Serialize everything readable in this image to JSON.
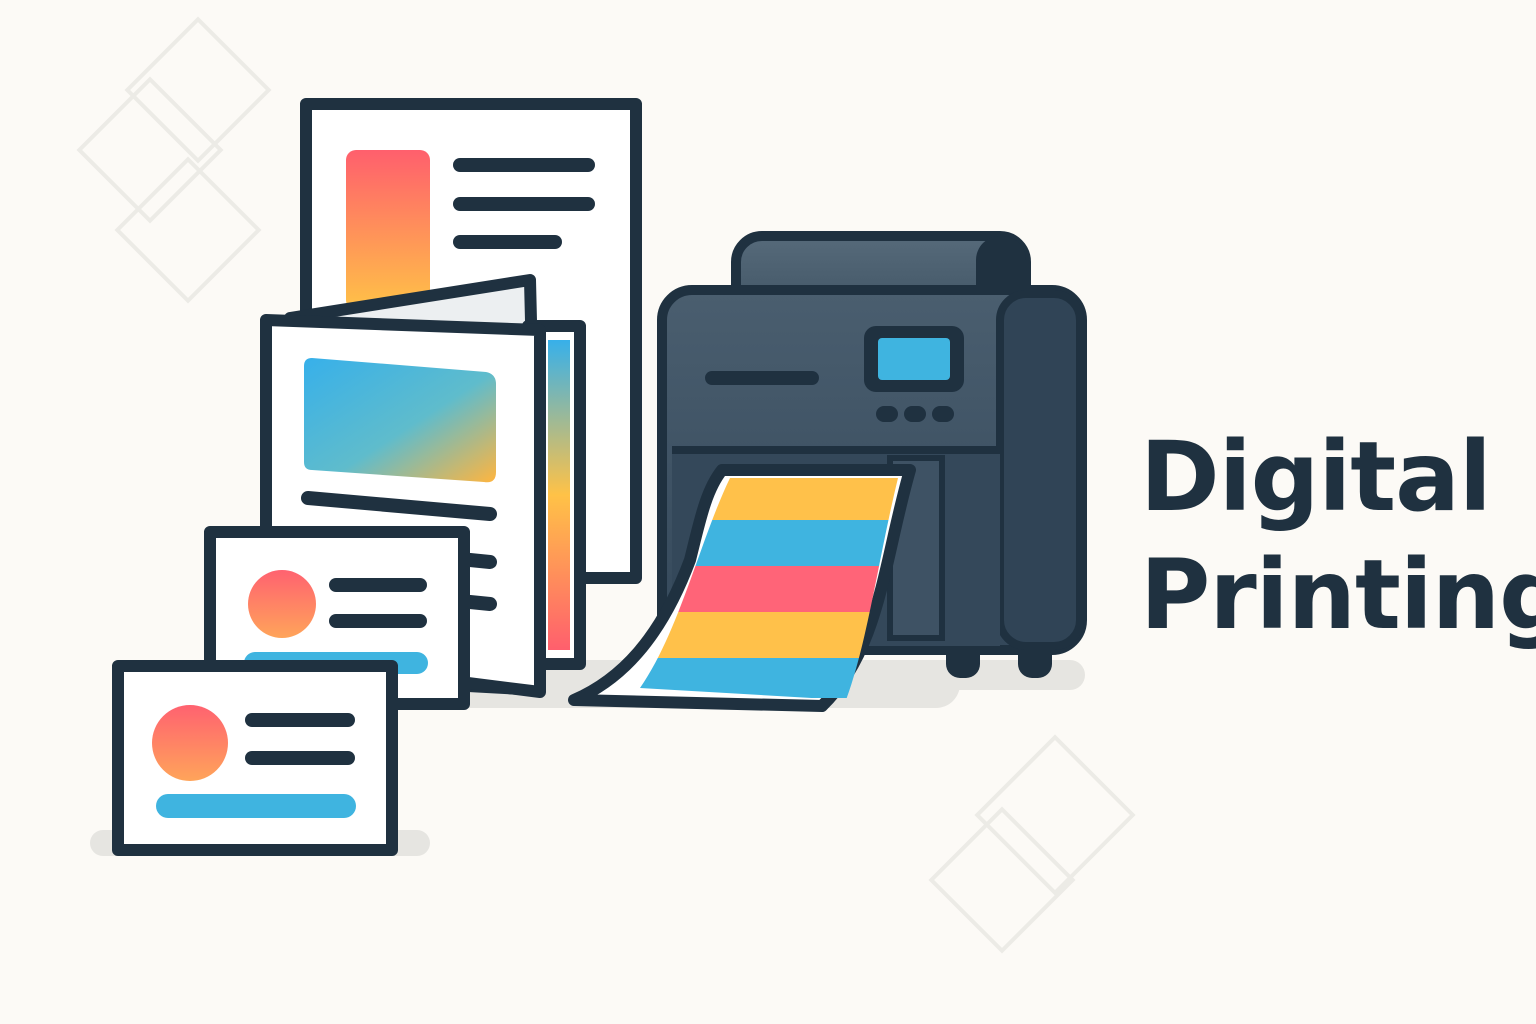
{
  "headline": {
    "line1": "Digital",
    "line2": "Printing"
  },
  "colors": {
    "background": "#fcfaf6",
    "outline": "#1f3140",
    "printer_body": "#2f4150",
    "screen": "#3fb4e0",
    "red": "#ff6072",
    "yellow": "#ffc14a",
    "blue": "#3fb4e0",
    "orange": "#ff8a5a"
  },
  "icons": [
    "poster-icon",
    "brochure-icon",
    "business-card-icon",
    "printer-icon",
    "printed-sheet-icon"
  ]
}
